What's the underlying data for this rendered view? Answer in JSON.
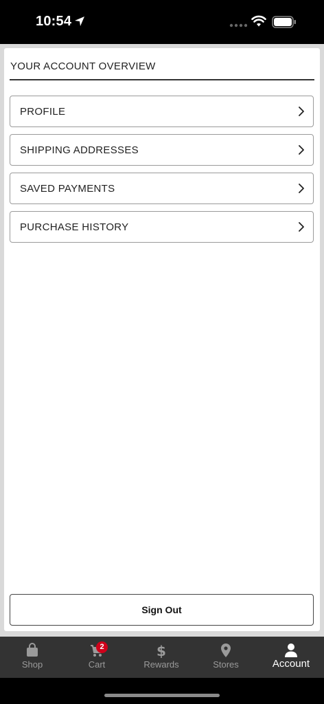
{
  "status_bar": {
    "time": "10:54"
  },
  "account": {
    "title": "YOUR ACCOUNT OVERVIEW",
    "items": [
      {
        "label": "PROFILE"
      },
      {
        "label": "SHIPPING ADDRESSES"
      },
      {
        "label": "SAVED PAYMENTS"
      },
      {
        "label": "PURCHASE HISTORY"
      }
    ],
    "sign_out_label": "Sign Out"
  },
  "tabbar": {
    "tabs": [
      {
        "label": "Shop",
        "icon": "shopping-bag-icon"
      },
      {
        "label": "Cart",
        "icon": "cart-icon",
        "badge": "2"
      },
      {
        "label": "Rewards",
        "icon": "dollar-icon"
      },
      {
        "label": "Stores",
        "icon": "location-pin-icon"
      },
      {
        "label": "Account",
        "icon": "user-icon",
        "active": true
      }
    ]
  },
  "colors": {
    "tabbar_bg": "#333333",
    "tab_inactive": "#9a9a9a",
    "tab_active": "#ffffff",
    "badge": "#d0021b"
  }
}
